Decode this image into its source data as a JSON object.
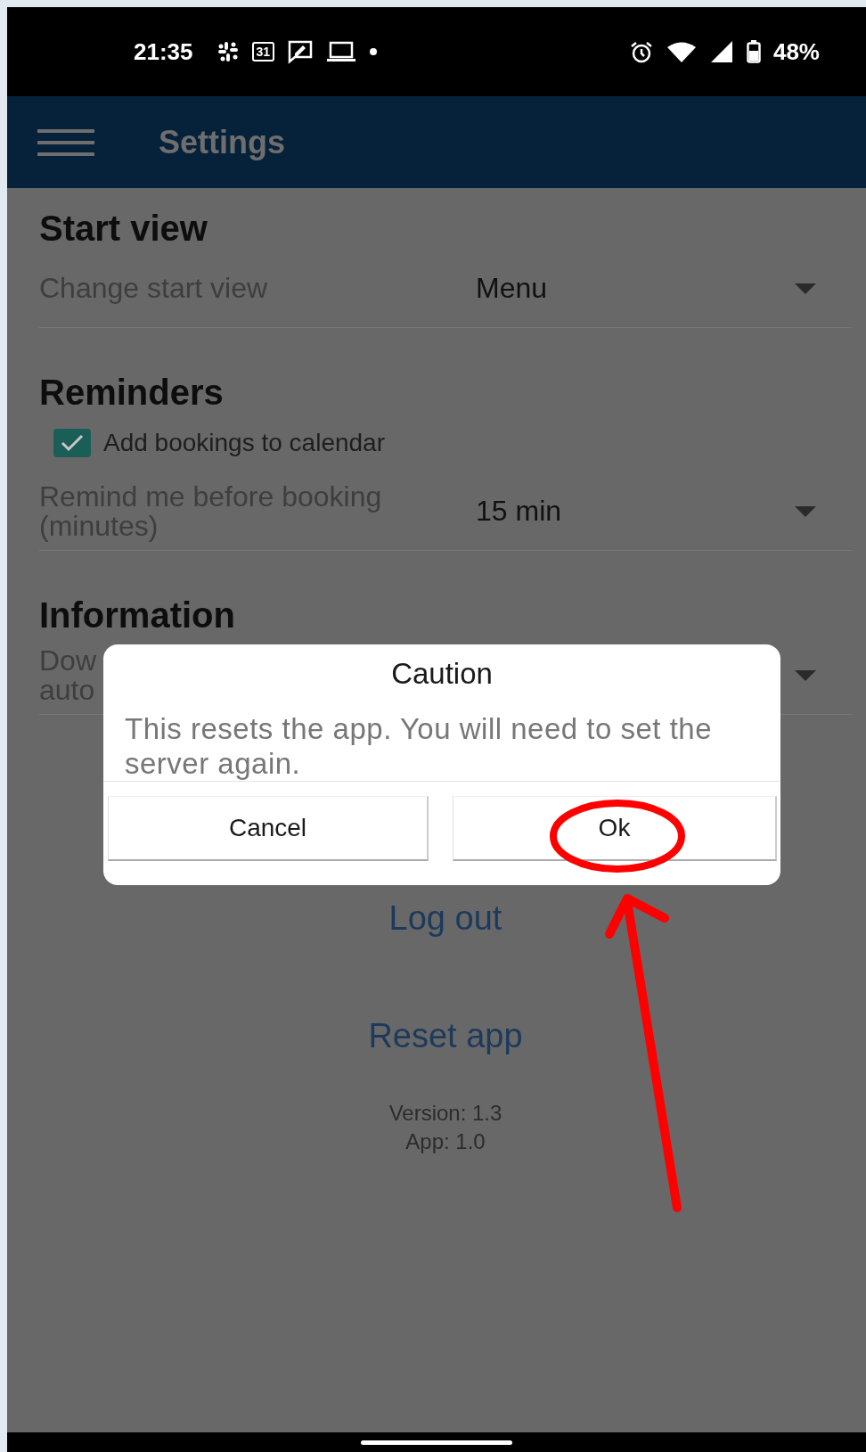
{
  "status_bar": {
    "time": "21:35",
    "calendar_day": "31",
    "battery": "48%"
  },
  "app_bar": {
    "title": "Settings"
  },
  "sections": [
    {
      "title": "Start view",
      "rows": [
        {
          "kind": "dropdown",
          "label": "Change start view",
          "value": "Menu"
        }
      ]
    },
    {
      "title": "Reminders",
      "rows": [
        {
          "kind": "checkbox",
          "label": "Add bookings to calendar",
          "checked": true
        },
        {
          "kind": "dropdown",
          "label": "Remind me before booking\n(minutes)",
          "value": "15 min"
        }
      ]
    },
    {
      "title": "Information",
      "rows": [
        {
          "kind": "dropdown",
          "label": "Dow\nauto"
        }
      ]
    }
  ],
  "links": [
    {
      "label": "Log out"
    },
    {
      "label": "Reset app"
    }
  ],
  "version_lines": [
    "Version: 1.3",
    "App: 1.0"
  ],
  "dialog": {
    "title": "Caution",
    "message": "This resets the app. You will need to set the server again.",
    "buttons": [
      {
        "label": "Cancel"
      },
      {
        "label": "Ok"
      }
    ]
  }
}
